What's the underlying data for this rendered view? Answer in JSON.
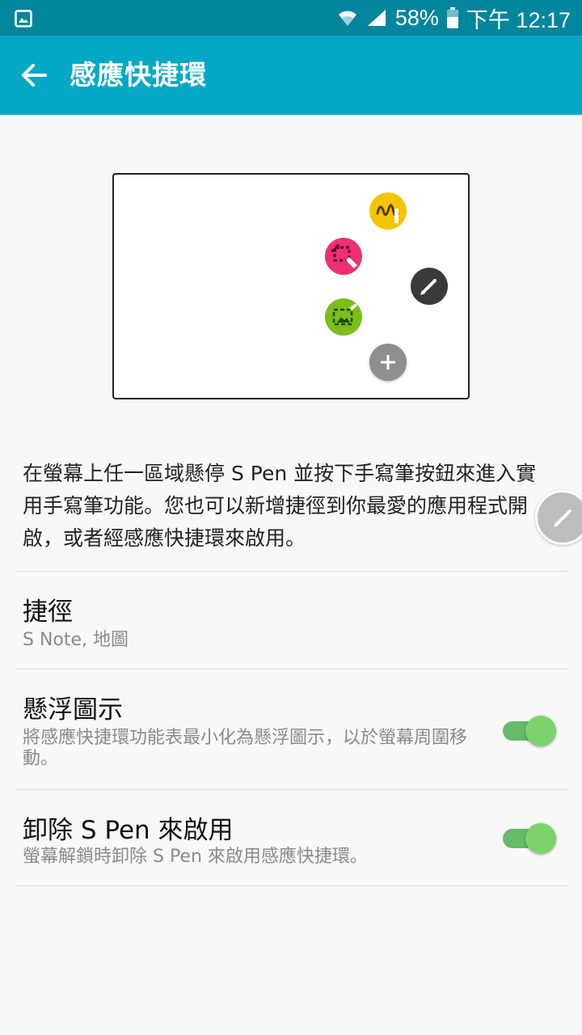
{
  "status_bar": {
    "battery_percent": "58%",
    "time": "下午 12:17"
  },
  "app_bar": {
    "title": "感應快捷環"
  },
  "illustration": {
    "icons": [
      "handwriting-app-icon",
      "screen-select-icon",
      "image-clip-icon",
      "pen-menu-icon",
      "add-shortcut-icon"
    ]
  },
  "description": "在螢幕上任一區域懸停 S Pen 並按下手寫筆按鈕來進入實用手寫筆功能。您也可以新增捷徑到你最愛的應用程式開啟，或者經感應快捷環來啟用。",
  "settings": {
    "shortcuts": {
      "title": "捷徑",
      "subtitle": "S Note, 地圖"
    },
    "floating_icon": {
      "title": "懸浮圖示",
      "subtitle": "將感應快捷環功能表最小化為懸浮圖示，以於螢幕周圍移動。",
      "enabled": true
    },
    "detach_spen": {
      "title": "卸除 S Pen 來啟用",
      "subtitle": "螢幕解鎖時卸除 S Pen 來啟用感應快捷環。",
      "enabled": true
    }
  },
  "colors": {
    "status_bar": "#03869c",
    "app_bar": "#03a9c4",
    "toggle_on": "#7dd36b"
  }
}
